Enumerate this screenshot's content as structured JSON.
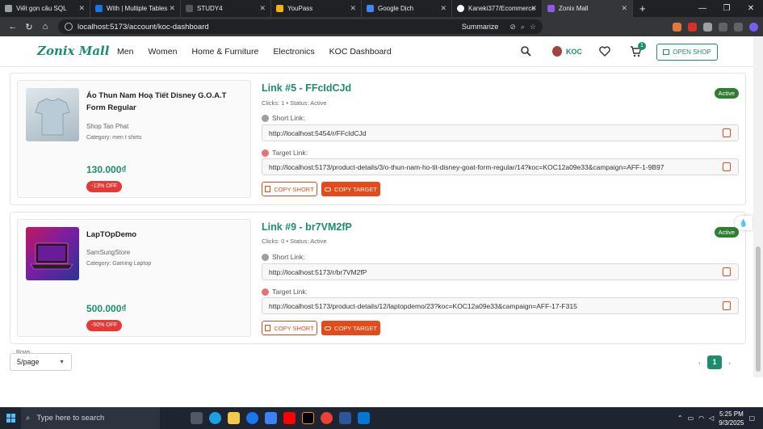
{
  "browser": {
    "tabs": [
      {
        "title": "Viết gọn câu SQL",
        "color": "#9aa0a6",
        "active": false
      },
      {
        "title": "With | Multiple Tables",
        "color": "#1a73e8",
        "active": false
      },
      {
        "title": "STUDY4",
        "color": "#333333",
        "active": false
      },
      {
        "title": "YouPass",
        "color": "#f4b400",
        "active": false
      },
      {
        "title": "Google Dịch",
        "color": "#4285f4",
        "active": false
      },
      {
        "title": "Kaneki377/Ecommerce",
        "color": "#ffffff",
        "active": false
      },
      {
        "title": "Zonix Mall",
        "color": "#8e5be8",
        "active": true
      }
    ],
    "url": "localhost:5173/account/koc-dashboard",
    "summarize_label": "Summarize",
    "extension_badge": "12"
  },
  "header": {
    "logo": "Zonix Mall",
    "nav": [
      "Men",
      "Women",
      "Home & Furniture",
      "Electronics",
      "KOC Dashboard"
    ],
    "user_label": "KOC",
    "cart_count": "1",
    "open_shop_label": "OPEN SHOP",
    "accent": "#1e8c6e"
  },
  "links": [
    {
      "product_name": "Áo Thun Nam Hoạ Tiết Disney G.O.A.T Form Regular",
      "shop": "Shop Tan Phat",
      "category": "Category: men t shirts",
      "price": "130.000₫",
      "discount": "-13% OFF",
      "title": "Link #5 - FFcIdCJd",
      "meta": "Clicks: 1 • Status: Active",
      "status": "Active",
      "short_label": "Short Link:",
      "short_url": "http://localhost:5454/r/FFcIdCJd",
      "target_label": "Target Link:",
      "target_url": "http://localhost:5173/product-details/3/o-thun-nam-ho-tit-disney-goat-form-regular/14?koc=KOC12a09e33&campaign=AFF-1-9B97",
      "copy_short": "COPY SHORT",
      "copy_target": "COPY TARGET"
    },
    {
      "product_name": "LapTOpDemo",
      "shop": "SamSungStore",
      "category": "Category: Gaming Laptop",
      "price": "500.000₫",
      "discount": "-50% OFF",
      "title": "Link #9 - br7VM2fP",
      "meta": "Clicks: 0 • Status: Active",
      "status": "Active",
      "short_label": "Short Link:",
      "short_url": "http://localhost:5173/r/br7VM2fP",
      "target_label": "Target Link:",
      "target_url": "http://localhost:5173/product-details/12/laptopdemo/23?koc=KOC12a09e33&campaign=AFF-17-F315",
      "copy_short": "COPY SHORT",
      "copy_target": "COPY TARGET"
    }
  ],
  "pagination": {
    "rows_label": "Rows",
    "rows_value": "5/page",
    "current_page": "1"
  },
  "taskbar": {
    "search_placeholder": "Type here to search",
    "time": "5:25 PM",
    "date": "9/3/2025"
  }
}
